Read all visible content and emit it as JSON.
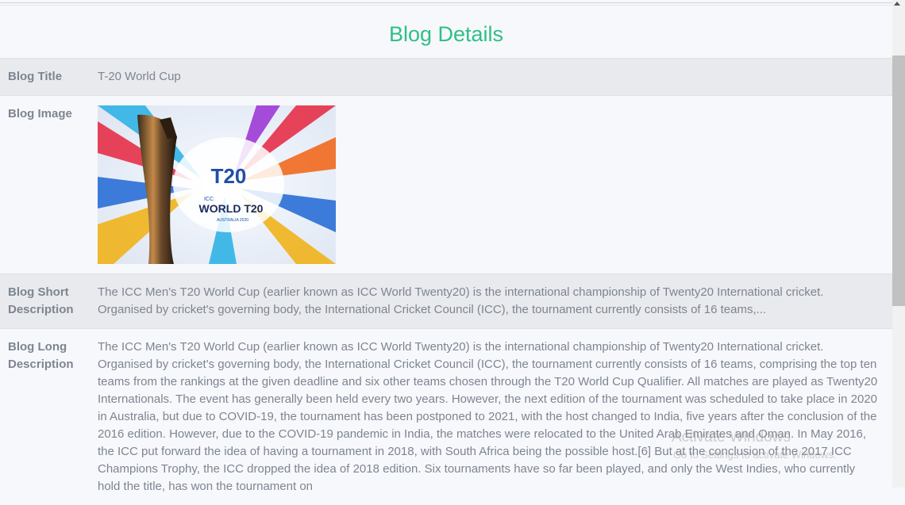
{
  "page": {
    "title": "Blog Details"
  },
  "rows": {
    "title": {
      "label": "Blog Title",
      "value": "T-20 World Cup"
    },
    "image": {
      "label": "Blog Image",
      "image_text": "WORLD T20",
      "image_subtext": "AUSTRALIA 2020",
      "image_badge": "T20",
      "image_icc": "ICC"
    },
    "short": {
      "label": "Blog Short Description",
      "value": "The ICC Men's T20 World Cup (earlier known as ICC World Twenty20) is the international championship of Twenty20 International cricket. Organised by cricket's governing body, the International Cricket Council (ICC), the tournament currently consists of 16 teams,..."
    },
    "long": {
      "label": "Blog Long Description",
      "value": "The ICC Men's T20 World Cup (earlier known as ICC World Twenty20) is the international championship of Twenty20 International cricket. Organised by cricket's governing body, the International Cricket Council (ICC), the tournament currently consists of 16 teams, comprising the top ten teams from the rankings at the given deadline and six other teams chosen through the T20 World Cup Qualifier. All matches are played as Twenty20 Internationals. The event has generally been held every two years. However, the next edition of the tournament was scheduled to take place in 2020 in Australia, but due to COVID-19, the tournament has been postponed to 2021, with the host changed to India, five years after the conclusion of the 2016 edition. However, due to the COVID-19 pandemic in India, the matches were relocated to the United Arab Emirates and Oman. In May 2016, the ICC put forward the idea of having a tournament in 2018, with South Africa being the possible host.[6] But at the conclusion of the 2017 ICC Champions Trophy, the ICC dropped the idea of 2018 edition. Six tournaments have so far been played, and only the West Indies, who currently hold the title, has won the tournament on"
    }
  },
  "watermark": {
    "line1": "Activate Windows",
    "line2": "Go to Settings to activate Windows."
  },
  "colors": {
    "title": "#2fbf86",
    "text": "#7d8591",
    "row_alt": "#e9eaed",
    "background": "#f7f8fb"
  }
}
